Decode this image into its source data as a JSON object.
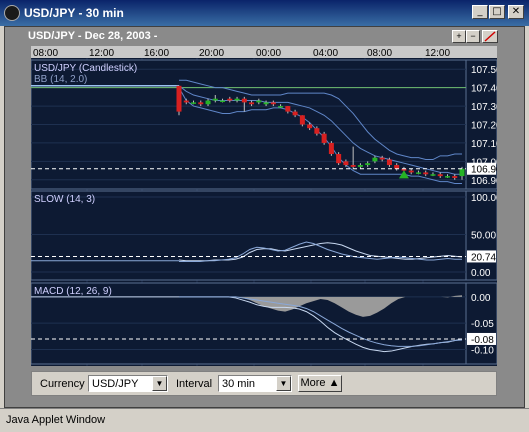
{
  "window": {
    "title": "USD/JPY - 30 min",
    "status": "Java Applet Window"
  },
  "header": {
    "title": "USD/JPY - Dec 28, 2003 -",
    "zoom_in": "+",
    "zoom_out": "−",
    "draw_tool": "draw-line-icon"
  },
  "time_labels": [
    "08:00",
    "12:00",
    "16:00",
    "20:00",
    "00:00",
    "04:00",
    "08:00",
    "12:00"
  ],
  "colors": {
    "background": "#0d1a33",
    "grid": "#1e3050",
    "price_line": "#9ac3f0",
    "bollinger": "#5f86c8",
    "up_candle": "#25b325",
    "down_candle": "#d82020",
    "resistance": "#6fbf6f"
  },
  "controls": {
    "currency_label": "Currency",
    "currency_value": "USD/JPY",
    "interval_label": "Interval",
    "interval_value": "30 min",
    "more_label": "More ▲"
  },
  "chart_data": [
    {
      "type": "candlestick",
      "title": "USD/JPY (Candlestick)",
      "subtitle": "BB (14, 2.0)",
      "x": [
        "16:30",
        "17:00",
        "17:30",
        "18:00",
        "18:30",
        "19:00",
        "19:30",
        "20:00",
        "20:30",
        "21:00",
        "21:30",
        "22:00",
        "22:30",
        "23:00",
        "23:30",
        "00:00",
        "00:30",
        "01:00",
        "01:30",
        "02:00",
        "02:30",
        "03:00",
        "03:30",
        "04:00",
        "04:30",
        "05:00",
        "05:30",
        "06:00",
        "06:30",
        "07:00",
        "07:30",
        "08:00",
        "08:30",
        "09:00",
        "09:30",
        "10:00",
        "10:30",
        "11:00",
        "11:30",
        "12:00"
      ],
      "open": [
        107.41,
        107.33,
        107.32,
        107.32,
        107.31,
        107.33,
        107.33,
        107.34,
        107.33,
        107.34,
        107.32,
        107.32,
        107.31,
        107.32,
        107.3,
        107.3,
        107.27,
        107.25,
        107.2,
        107.18,
        107.15,
        107.1,
        107.04,
        107.0,
        106.98,
        106.97,
        106.98,
        107.0,
        107.02,
        107.01,
        106.98,
        106.96,
        106.95,
        106.94,
        106.94,
        106.93,
        106.93,
        106.92,
        106.92,
        106.92
      ],
      "close": [
        107.27,
        107.32,
        107.32,
        107.31,
        107.33,
        107.34,
        107.33,
        107.33,
        107.34,
        107.32,
        107.31,
        107.33,
        107.32,
        107.31,
        107.3,
        107.27,
        107.25,
        107.2,
        107.18,
        107.15,
        107.1,
        107.04,
        106.99,
        106.98,
        106.97,
        106.98,
        106.99,
        107.02,
        107.01,
        106.98,
        106.96,
        106.95,
        106.94,
        106.94,
        106.93,
        106.93,
        106.92,
        106.92,
        106.91,
        106.96
      ],
      "high": [
        107.41,
        107.34,
        107.33,
        107.33,
        107.34,
        107.36,
        107.34,
        107.35,
        107.35,
        107.35,
        107.33,
        107.34,
        107.33,
        107.33,
        107.31,
        107.3,
        107.28,
        107.25,
        107.21,
        107.19,
        107.16,
        107.11,
        107.05,
        107.01,
        107.08,
        106.99,
        107.0,
        107.03,
        107.03,
        107.02,
        106.99,
        106.97,
        106.96,
        106.95,
        106.95,
        106.94,
        106.94,
        106.93,
        106.93,
        106.97
      ],
      "low": [
        107.25,
        107.31,
        107.31,
        107.3,
        107.3,
        107.32,
        107.32,
        107.32,
        107.32,
        107.27,
        107.3,
        107.31,
        107.3,
        107.3,
        107.29,
        107.26,
        107.24,
        107.19,
        107.17,
        107.14,
        107.09,
        107.03,
        106.98,
        106.97,
        106.96,
        106.96,
        106.97,
        106.99,
        107.0,
        106.97,
        106.95,
        106.94,
        106.93,
        106.93,
        106.92,
        106.92,
        106.91,
        106.91,
        106.9,
        106.9
      ],
      "bb_upper": [
        107.44,
        107.44,
        107.43,
        107.42,
        107.41,
        107.4,
        107.4,
        107.39,
        107.38,
        107.37,
        107.36,
        107.36,
        107.36,
        107.36,
        107.36,
        107.37,
        107.37,
        107.37,
        107.37,
        107.37,
        107.37,
        107.36,
        107.34,
        107.3,
        107.26,
        107.21,
        107.16,
        107.12,
        107.09,
        107.06,
        107.04,
        107.03,
        107.02,
        107.02,
        107.01,
        107.01,
        107.03,
        107.03,
        107.04,
        107.04
      ],
      "bb_middle": [
        107.41,
        107.38,
        107.36,
        107.35,
        107.34,
        107.33,
        107.33,
        107.33,
        107.33,
        107.33,
        107.33,
        107.33,
        107.32,
        107.32,
        107.32,
        107.32,
        107.31,
        107.3,
        107.29,
        107.27,
        107.25,
        107.22,
        107.18,
        107.14,
        107.1,
        107.07,
        107.05,
        107.03,
        107.02,
        107.01,
        107.0,
        106.99,
        106.98,
        106.97,
        106.96,
        106.95,
        106.94,
        106.94,
        106.93,
        106.93
      ],
      "bb_lower": [
        107.4,
        107.33,
        107.3,
        107.29,
        107.28,
        107.27,
        107.26,
        107.26,
        107.27,
        107.27,
        107.28,
        107.28,
        107.28,
        107.29,
        107.29,
        107.28,
        107.26,
        107.24,
        107.21,
        107.17,
        107.13,
        107.08,
        107.02,
        106.98,
        106.95,
        106.93,
        106.93,
        106.93,
        106.93,
        106.93,
        106.93,
        106.93,
        106.92,
        106.92,
        106.91,
        106.9,
        106.89,
        106.89,
        106.88,
        106.88
      ],
      "resistance": 107.4,
      "current_value": "106.96",
      "current_marker": "106.96",
      "ylim": [
        106.85,
        107.55
      ],
      "yticks": [
        "107.50",
        "107.40",
        "107.30",
        "107.20",
        "107.10",
        "107.00",
        "106.90"
      ]
    },
    {
      "type": "line",
      "title": "SLOW (14, 3)",
      "series": [
        {
          "values": [
            16,
            15,
            15,
            15,
            15,
            16,
            16,
            16,
            17,
            20,
            26,
            30,
            31,
            31,
            29,
            28,
            30,
            32,
            34,
            36,
            38,
            39,
            38,
            36,
            32,
            28,
            25,
            22,
            21,
            20,
            19,
            18,
            17,
            17,
            18,
            19,
            20,
            21,
            22,
            21,
            20
          ]
        },
        {
          "values": [
            14,
            14,
            14,
            14,
            15,
            15,
            16,
            17,
            19,
            24,
            30,
            33,
            32,
            30,
            28,
            29,
            33,
            37,
            40,
            38,
            34,
            30,
            27,
            24,
            22,
            20,
            19,
            18,
            17,
            18,
            19,
            20,
            19,
            18,
            17,
            16,
            16,
            17,
            18,
            17,
            17
          ]
        }
      ],
      "current_value": "20.74",
      "ylim": [
        0,
        100
      ],
      "yticks": [
        "100.00",
        "50.00",
        "0.00"
      ]
    },
    {
      "type": "area",
      "title": "MACD (12, 26, 9)",
      "series": [
        {
          "name": "histogram",
          "values": [
            0,
            0,
            0,
            0,
            0,
            0,
            0,
            0,
            0,
            -0.002,
            -0.006,
            -0.012,
            -0.018,
            -0.022,
            -0.026,
            -0.028,
            -0.024,
            -0.018,
            -0.012,
            -0.008,
            -0.004,
            -0.006,
            -0.012,
            -0.02,
            -0.028,
            -0.034,
            -0.038,
            -0.036,
            -0.03,
            -0.022,
            -0.012,
            -0.004,
            0,
            0,
            0,
            0,
            0,
            0,
            -0.001,
            0.002,
            0.003
          ]
        },
        {
          "values": [
            0,
            0,
            0,
            0,
            0,
            0,
            0,
            0,
            -0.002,
            -0.006,
            -0.01,
            -0.015,
            -0.018,
            -0.02,
            -0.02,
            -0.02,
            -0.021,
            -0.023,
            -0.028,
            -0.036,
            -0.046,
            -0.058,
            -0.068,
            -0.076,
            -0.083,
            -0.09,
            -0.096,
            -0.1,
            -0.102,
            -0.104,
            -0.103,
            -0.1,
            -0.097,
            -0.094,
            -0.092,
            -0.09,
            -0.089,
            -0.087,
            -0.086,
            -0.083,
            -0.08
          ]
        },
        {
          "values": [
            0,
            0,
            0,
            0,
            0,
            0,
            0,
            0,
            0,
            -0.002,
            -0.004,
            -0.006,
            -0.008,
            -0.01,
            -0.012,
            -0.014,
            -0.016,
            -0.018,
            -0.022,
            -0.028,
            -0.036,
            -0.044,
            -0.052,
            -0.06,
            -0.067,
            -0.073,
            -0.079,
            -0.084,
            -0.088,
            -0.091,
            -0.093,
            -0.094,
            -0.094,
            -0.094,
            -0.093,
            -0.091,
            -0.089,
            -0.087,
            -0.085,
            -0.083,
            -0.082
          ]
        }
      ],
      "current_value": "-0.08",
      "ylim": [
        -0.12,
        0.015
      ],
      "yticks": [
        "0.00",
        "-0.05",
        "-0.10"
      ]
    }
  ]
}
